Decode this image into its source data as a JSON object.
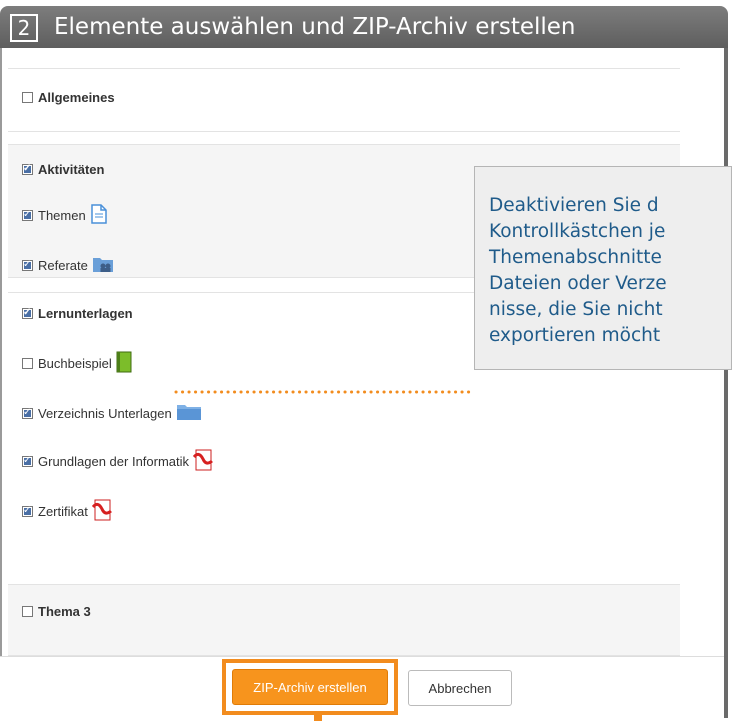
{
  "header": {
    "step_number": "2",
    "title": "Elemente auswählen und ZIP-Archiv erstellen"
  },
  "sections": [
    {
      "title": "Allgemeines",
      "checked": false,
      "items": []
    },
    {
      "title": "Aktivitäten",
      "checked": true,
      "items": [
        {
          "label": "Themen",
          "checked": true,
          "icon": "page-icon"
        },
        {
          "label": "Referate",
          "checked": true,
          "icon": "group-folder-icon"
        }
      ]
    },
    {
      "title": "Lernunterlagen",
      "checked": true,
      "items": [
        {
          "label": "Buchbeispiel",
          "checked": false,
          "icon": "green-book-icon"
        },
        {
          "label": "Verzeichnis Unterlagen",
          "checked": true,
          "icon": "folder-icon"
        },
        {
          "label": "Grundlagen der Informatik",
          "checked": true,
          "icon": "pdf-icon"
        },
        {
          "label": "Zertifikat",
          "checked": true,
          "icon": "pdf-icon"
        }
      ]
    },
    {
      "title": "Thema 3",
      "checked": false,
      "items": []
    }
  ],
  "callout": {
    "text": "Deaktivieren Sie d\nKontrollkästchen je\nThemenabschnitte\nDateien oder Verze\nnisse, die Sie nicht\nexportieren möcht"
  },
  "footer": {
    "create_zip_label": "ZIP-Archiv erstellen",
    "cancel_label": "Abbrechen"
  },
  "colors": {
    "accent": "#f7941d",
    "title_bar": "#6e6e6e",
    "callout_text": "#1f5b8a",
    "checkbox_checked": "#4a6fa5"
  }
}
